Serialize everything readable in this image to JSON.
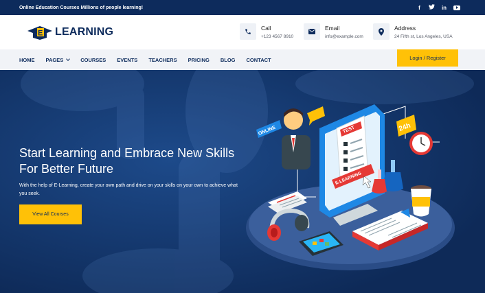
{
  "topbar": {
    "tagline": "Online Education Courses Millions of people learning!",
    "social_icons": [
      "facebook-icon",
      "twitter-icon",
      "linkedin-icon",
      "youtube-icon"
    ],
    "facebook_glyph": "f",
    "twitter_glyph": "t",
    "linkedin_glyph": "in"
  },
  "header": {
    "logo_letter": "E",
    "logo_text": "LEARNING",
    "contacts": [
      {
        "icon": "phone-icon",
        "title": "Call",
        "value": "+123 4567 8910"
      },
      {
        "icon": "envelope-icon",
        "title": "Email",
        "value": "info@example.com"
      },
      {
        "icon": "map-pin-icon",
        "title": "Address",
        "value": "24 Fifth st, Los Angeles, USA"
      }
    ]
  },
  "nav": {
    "items": [
      "HOME",
      "PAGES",
      "COURSES",
      "EVENTS",
      "TEACHERS",
      "PRICING",
      "BLOG",
      "CONTACT"
    ],
    "login_label": "Login / Register"
  },
  "hero": {
    "title": "Start Learning and Embrace New Skills For Better Future",
    "description": "With the help of E-Learning, create your own path and drive on your skills on your own to achieve what you seek.",
    "button_label": "View All Courses",
    "illustration": {
      "online_badge": "ONLINE",
      "test_label": "TEST",
      "screen_label": "E-LEARNING",
      "clock_badge": "24h"
    }
  },
  "colors": {
    "navy": "#0d2b5c",
    "hero_bg": "#143468",
    "accent_yellow": "#ffc107",
    "nav_bg": "#f1f3f7"
  }
}
